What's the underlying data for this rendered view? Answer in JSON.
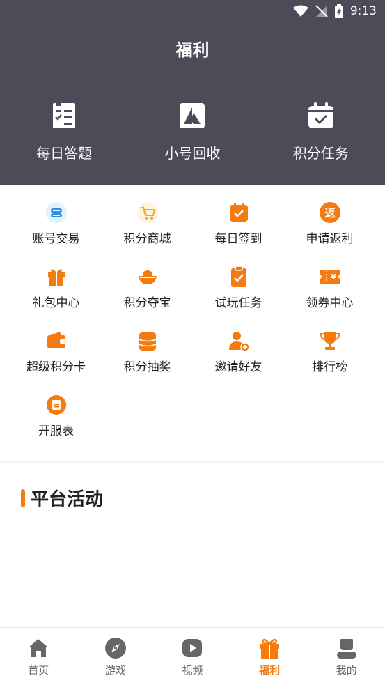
{
  "status": {
    "time": "9:13"
  },
  "page": {
    "title": "福利"
  },
  "top_features": [
    {
      "label": "每日答题",
      "icon": "quiz-checklist-icon"
    },
    {
      "label": "小号回收",
      "icon": "recycle-triangle-icon"
    },
    {
      "label": "积分任务",
      "icon": "calendar-check-icon"
    }
  ],
  "grid": [
    {
      "label": "账号交易",
      "icon": "account-trade-icon"
    },
    {
      "label": "积分商城",
      "icon": "shopping-cart-icon"
    },
    {
      "label": "每日签到",
      "icon": "daily-signin-icon"
    },
    {
      "label": "申请返利",
      "icon": "rebate-icon"
    },
    {
      "label": "礼包中心",
      "icon": "gift-icon"
    },
    {
      "label": "积分夺宝",
      "icon": "treasure-bowl-icon"
    },
    {
      "label": "试玩任务",
      "icon": "clipboard-task-icon"
    },
    {
      "label": "领券中心",
      "icon": "coupon-icon"
    },
    {
      "label": "超级积分卡",
      "icon": "wallet-card-icon"
    },
    {
      "label": "积分抽奖",
      "icon": "coin-stack-icon"
    },
    {
      "label": "邀请好友",
      "icon": "invite-user-icon"
    },
    {
      "label": "排行榜",
      "icon": "trophy-icon"
    },
    {
      "label": "开服表",
      "icon": "server-list-icon"
    }
  ],
  "section": {
    "title": "平台活动"
  },
  "tabs": [
    {
      "label": "首页",
      "icon": "home-icon",
      "active": false
    },
    {
      "label": "游戏",
      "icon": "compass-icon",
      "active": false
    },
    {
      "label": "视频",
      "icon": "play-icon",
      "active": false
    },
    {
      "label": "福利",
      "icon": "gift-icon",
      "active": true
    },
    {
      "label": "我的",
      "icon": "user-icon",
      "active": false
    }
  ],
  "colors": {
    "accent": "#f47b0f",
    "header_bg": "#4b4c57",
    "tab_inactive": "#666666"
  }
}
